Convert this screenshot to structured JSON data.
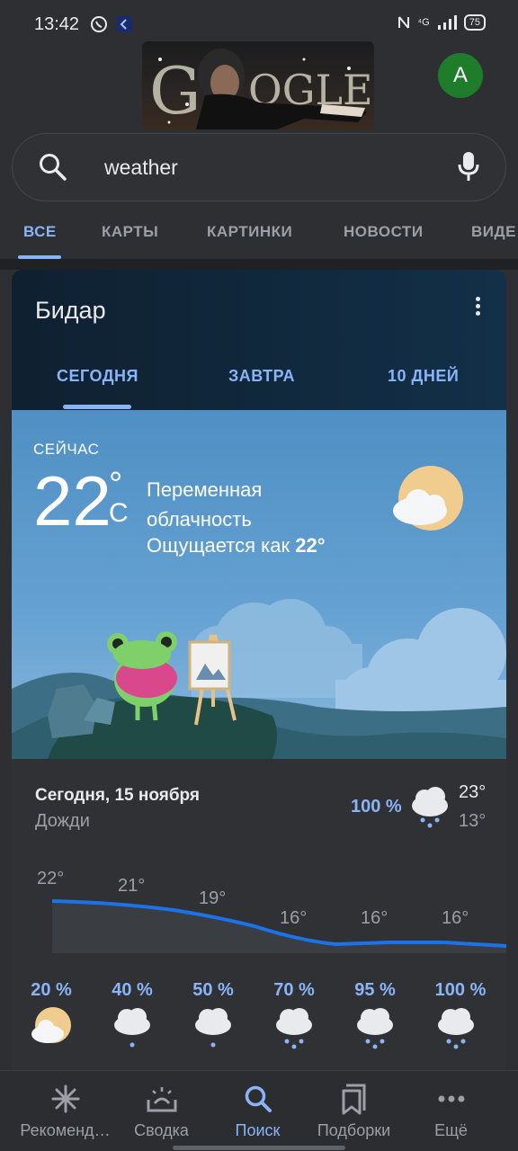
{
  "status": {
    "time": "13:42",
    "network": "⁴G",
    "battery": "75"
  },
  "avatar": {
    "initial": "A"
  },
  "search": {
    "query": "weather"
  },
  "tabs": [
    {
      "label": "ВСЕ"
    },
    {
      "label": "КАРТЫ"
    },
    {
      "label": "КАРТИНКИ"
    },
    {
      "label": "НОВОСТИ"
    },
    {
      "label": "ВИДЕ"
    }
  ],
  "weather": {
    "city": "Бидар",
    "tabs": {
      "today": "СЕГОДНЯ",
      "tomorrow": "ЗАВТРА",
      "ten_days": "10 ДНЕЙ"
    },
    "now_label": "СЕЙЧАС",
    "temp": "22",
    "deg": "°",
    "unit": "C",
    "condition_line1": "Переменная",
    "condition_line2": "облачность",
    "feels_prefix": "Ощущается как ",
    "feels_value": "22°",
    "summary": {
      "date": "Сегодня, 15 ноября",
      "condition": "Дожди",
      "precip": "100 %",
      "high": "23°",
      "low": "13°"
    },
    "hourly_temps": [
      "22°",
      "21°",
      "19°",
      "16°",
      "16°",
      "16°"
    ],
    "hourly_precip": [
      "20 %",
      "40 %",
      "50 %",
      "70 %",
      "95 %",
      "100 %"
    ],
    "hourly_icons": [
      "partly-cloudy-sun-icon",
      "cloud-light-rain-icon",
      "cloud-light-rain-icon",
      "cloud-rain-icon",
      "cloud-rain-icon",
      "cloud-rain-icon"
    ]
  },
  "bottom_nav": [
    {
      "label": "Рекоменд…",
      "icon": "asterisk-icon"
    },
    {
      "label": "Сводка",
      "icon": "inbox-sun-icon"
    },
    {
      "label": "Поиск",
      "icon": "search-icon",
      "active": true
    },
    {
      "label": "Подборки",
      "icon": "bookmarks-icon"
    },
    {
      "label": "Ещё",
      "icon": "more-icon"
    }
  ],
  "colors": {
    "accent": "#8ab4f8",
    "background": "#2d2f33",
    "card": "#303134"
  }
}
